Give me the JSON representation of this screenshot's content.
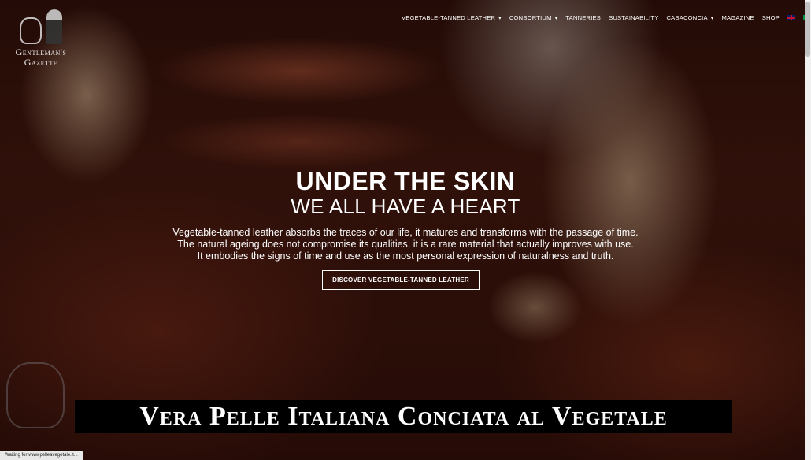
{
  "logo": {
    "line1": "Gentleman's",
    "line2": "Gazette"
  },
  "nav": {
    "items": [
      {
        "label": "VEGETABLE-TANNED LEATHER",
        "dropdown": true
      },
      {
        "label": "CONSORTIUM",
        "dropdown": true
      },
      {
        "label": "TANNERIES",
        "dropdown": false
      },
      {
        "label": "SUSTAINABILITY",
        "dropdown": false
      },
      {
        "label": "CASACONCIA",
        "dropdown": true
      },
      {
        "label": "MAGAZINE",
        "dropdown": false
      },
      {
        "label": "SHOP",
        "dropdown": false
      }
    ],
    "caret": "▾"
  },
  "hero": {
    "title": "UNDER THE SKIN",
    "subtitle": "WE ALL HAVE A HEART",
    "lines": [
      "Vegetable-tanned leather absorbs the traces of our life, it matures and transforms with the passage of time.",
      "The natural ageing does not compromise its qualities, it is a rare material that actually improves with use.",
      "It embodies the signs of time and use as the most personal expression of naturalness and truth."
    ],
    "cta_label": "DISCOVER VEGETABLE-TANNED LEATHER"
  },
  "caption": "Vera Pelle Italiana Conciata al Vegetale",
  "status_bar": "Waiting for www.pelleavegetale.it..."
}
